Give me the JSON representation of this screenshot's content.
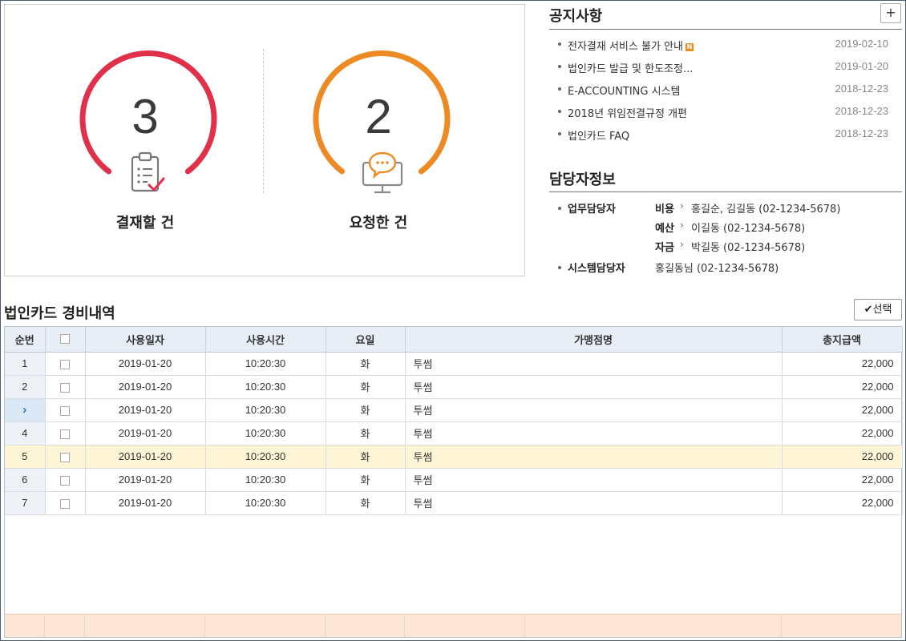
{
  "summary": {
    "pending_approval": {
      "count": "3",
      "label": "결재할 건",
      "color": "#e0304a",
      "icon": "clipboard-check-icon"
    },
    "my_requests": {
      "count": "2",
      "label": "요청한 건",
      "color": "#ee8a24",
      "icon": "monitor-chat-icon"
    }
  },
  "notice": {
    "title": "공지사항",
    "more_label": "+",
    "items": [
      {
        "title": "전자결재 서비스 불가 안내",
        "date": "2019-02-10",
        "new": true,
        "new_badge": "N"
      },
      {
        "title": "법인카드 발급 및 한도조정...",
        "date": "2019-01-20"
      },
      {
        "title": "E-ACCOUNTING 시스템",
        "date": "2018-12-23"
      },
      {
        "title": "2018년 위임전결규정 개편",
        "date": "2018-12-23"
      },
      {
        "title": "법인카드 FAQ",
        "date": "2018-12-23"
      }
    ]
  },
  "managers": {
    "title": "담당자정보",
    "work_role": "업무담당자",
    "work": [
      {
        "category": "비용",
        "value": "홍길순, 김길동 (02-1234-5678)"
      },
      {
        "category": "예산",
        "value": "이길동 (02-1234-5678)"
      },
      {
        "category": "자금",
        "value": "박길동 (02-1234-5678)"
      }
    ],
    "system_role": "시스템담당자",
    "system_value": "홍길동님 (02-1234-5678)"
  },
  "expenses": {
    "title": "법인카드 경비내역",
    "select_label": "선택",
    "columns": [
      "순번",
      "",
      "사용일자",
      "사용시간",
      "요일",
      "가맹점명",
      "총지급액"
    ],
    "rows": [
      {
        "no": "1",
        "date": "2019-01-20",
        "time": "10:20:30",
        "day": "화",
        "merchant": "투썸",
        "amount": "22,000"
      },
      {
        "no": "2",
        "date": "2019-01-20",
        "time": "10:20:30",
        "day": "화",
        "merchant": "투썸",
        "amount": "22,000"
      },
      {
        "no": "",
        "date": "2019-01-20",
        "time": "10:20:30",
        "day": "화",
        "merchant": "투썸",
        "amount": "22,000",
        "current": true
      },
      {
        "no": "4",
        "date": "2019-01-20",
        "time": "10:20:30",
        "day": "화",
        "merchant": "투썸",
        "amount": "22,000"
      },
      {
        "no": "5",
        "date": "2019-01-20",
        "time": "10:20:30",
        "day": "화",
        "merchant": "투썸",
        "amount": "22,000",
        "selected": true
      },
      {
        "no": "6",
        "date": "2019-01-20",
        "time": "10:20:30",
        "day": "화",
        "merchant": "투썸",
        "amount": "22,000"
      },
      {
        "no": "7",
        "date": "2019-01-20",
        "time": "10:20:30",
        "day": "화",
        "merchant": "투썸",
        "amount": "22,000"
      }
    ]
  }
}
